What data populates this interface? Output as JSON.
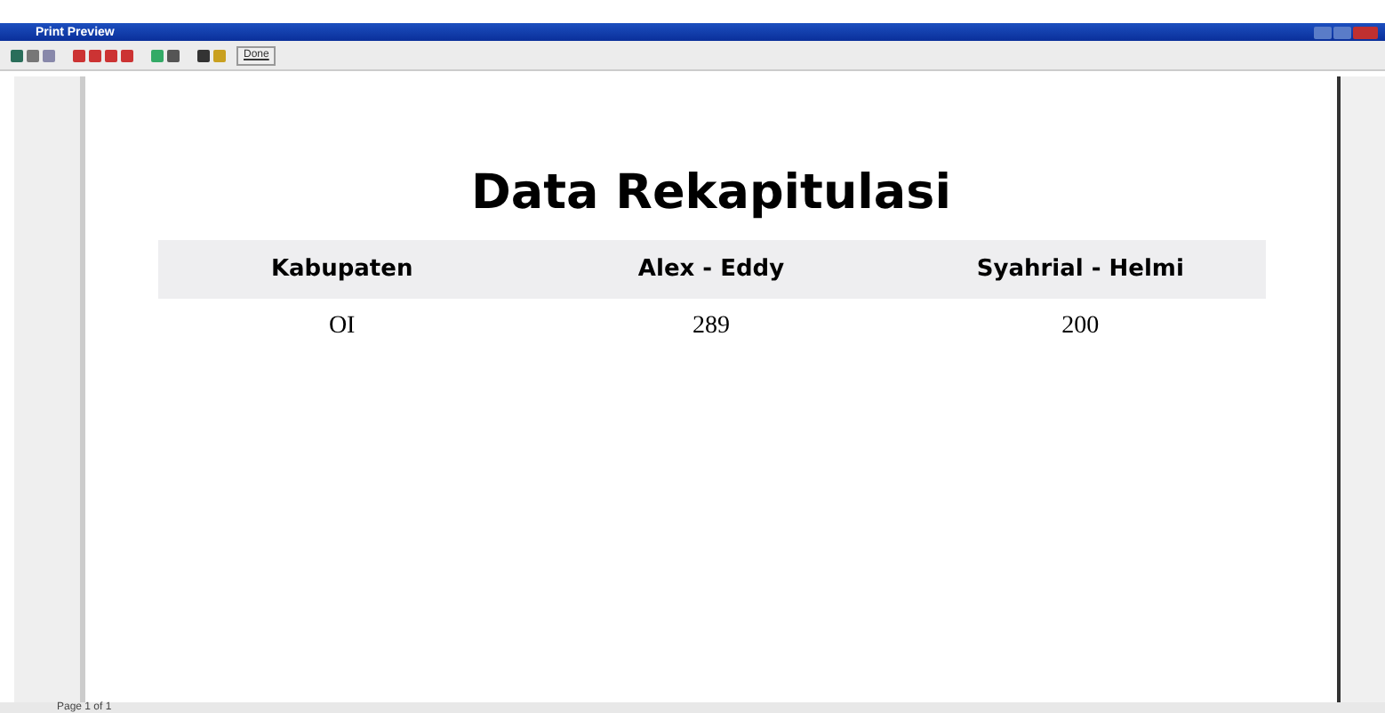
{
  "window": {
    "title": "Print Preview"
  },
  "toolbar": {
    "done_button": "Done"
  },
  "report": {
    "title": "Data Rekapitulasi",
    "columns": [
      "Kabupaten",
      "Alex - Eddy",
      "Syahrial - Helmi"
    ],
    "rows": [
      [
        "OI",
        "289",
        "200"
      ]
    ]
  },
  "status_bar": "Page 1 of 1"
}
